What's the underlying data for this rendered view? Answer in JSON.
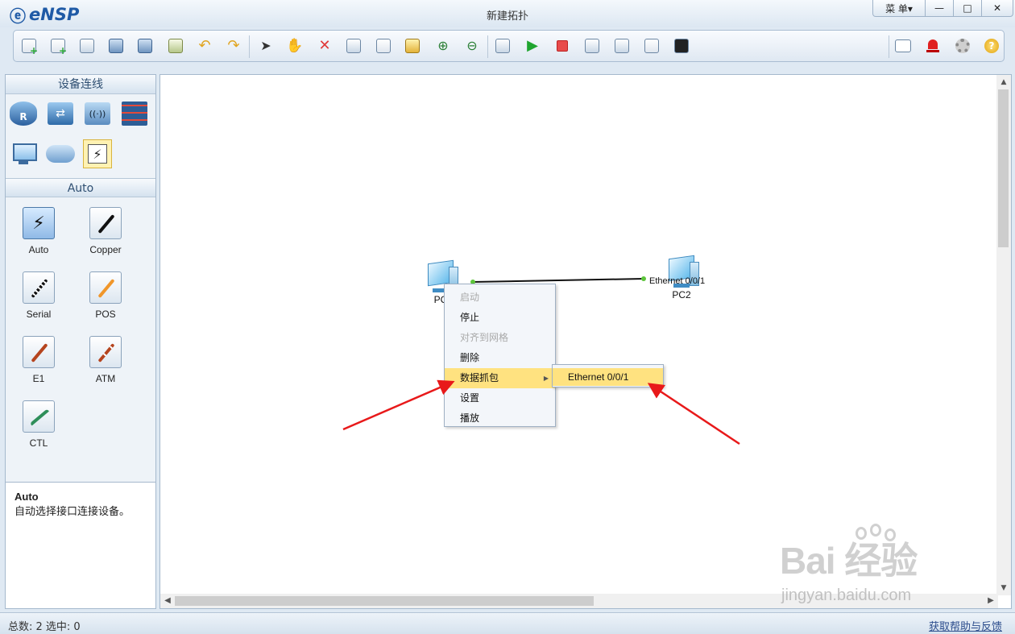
{
  "app": {
    "logo_text": "eNSP",
    "window_title": "新建拓扑"
  },
  "window_controls": {
    "menu_label": "菜 单▾",
    "minimize": "—",
    "maximize": "□",
    "close": "✕"
  },
  "toolbar": {
    "undo_glyph": "↶",
    "redo_glyph": "↷",
    "delete_glyph": "✕",
    "play_glyph": "▶",
    "cursor_glyph": "➤",
    "hand_glyph": "✋",
    "zoom_in_glyph": "⊕",
    "zoom_out_glyph": "⊖",
    "help_glyph": "?"
  },
  "left_panel": {
    "section_title": "设备连线",
    "device_router_label": "R",
    "device_switch_glyph": "⇄",
    "device_wlan_glyph": "((·))",
    "bolt_glyph": "⚡",
    "cable_section_title": "Auto",
    "cables": [
      {
        "label": "Auto",
        "color": "#111111"
      },
      {
        "label": "Copper",
        "color": "#111111"
      },
      {
        "label": "Serial",
        "color": "#111111"
      },
      {
        "label": "POS",
        "color": "#f0962a"
      },
      {
        "label": "E1",
        "color": "#b5441e"
      },
      {
        "label": "ATM",
        "color": "#b5441e"
      },
      {
        "label": "CTL",
        "color": "#2f8f5a"
      }
    ],
    "description": {
      "title": "Auto",
      "text": "自动选择接口连接设备。"
    }
  },
  "canvas": {
    "nodes": [
      {
        "label": "PC"
      },
      {
        "label": "PC2",
        "port_label": "Ethernet 0/0/1"
      }
    ],
    "link_color": "#111111",
    "port_dot_color": "#5cc43a"
  },
  "context_menu": {
    "items": [
      {
        "label": "启动",
        "disabled": true
      },
      {
        "label": "停止",
        "disabled": false
      },
      {
        "label": "对齐到网格",
        "disabled": true
      },
      {
        "label": "删除",
        "disabled": false
      },
      {
        "label": "数据抓包",
        "disabled": false,
        "active": true,
        "has_submenu": true
      },
      {
        "label": "设置",
        "disabled": false
      },
      {
        "label": "播放",
        "disabled": false
      }
    ],
    "submenu_arrow": "▶",
    "submenu": [
      {
        "label": "Ethernet 0/0/1"
      }
    ],
    "highlight_color": "#ffe280"
  },
  "scrollbars": {
    "up": "▲",
    "down": "▼",
    "left": "◀",
    "right": "▶"
  },
  "annotation": {
    "arrow_color": "#e8191a"
  },
  "watermark": {
    "big": "Bai  经验",
    "small": "jingyan.baidu.com"
  },
  "status": {
    "total_label": "总数: 2  选中: 0",
    "help_link": "获取帮助与反馈"
  }
}
